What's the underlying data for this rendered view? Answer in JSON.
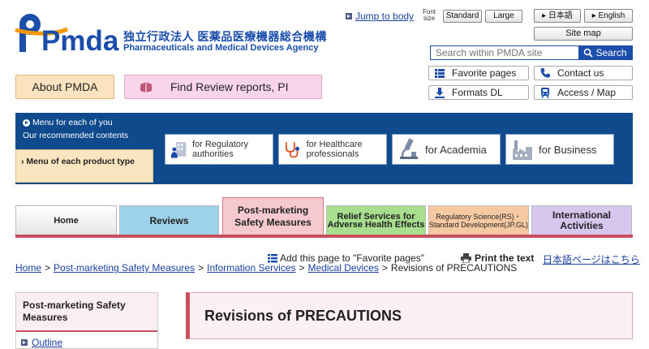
{
  "logo": {
    "text": "Pmda",
    "name_ja": "独立行政法人 医薬品医療機器総合機構",
    "name_en": "Pharmaceuticals and Medical Devices Agency"
  },
  "header": {
    "jump_to_body": "Jump to body",
    "font_size_label": "Font size",
    "font_standard": "Standard",
    "font_large": "Large",
    "lang_ja": "日本語",
    "lang_en": "English",
    "site_map": "Site map",
    "search_placeholder": "Search within PMDA site",
    "search_button": "Search",
    "favorite_pages": "Favorite pages",
    "contact_us": "Contact us",
    "formats_dl": "Formats DL",
    "access_map": "Access / Map"
  },
  "quick": {
    "about": "About PMDA",
    "review": "Find Review reports, PI"
  },
  "menu": {
    "for_you_line1": "Menu for each of you",
    "for_you_line2": "Our recommended contents",
    "product_type": "Menu of each product type",
    "cards": [
      {
        "label": "for Regulatory authorities"
      },
      {
        "label": "for Healthcare professionals"
      },
      {
        "label": "for Academia"
      },
      {
        "label": "for Business"
      }
    ]
  },
  "tabs": [
    {
      "label": "Home"
    },
    {
      "label": "Reviews"
    },
    {
      "label": "Post-marketing Safety Measures"
    },
    {
      "label": "Relief Services for Adverse Health Effects"
    },
    {
      "label": "Regulatory Science(RS)・Standard Development(JP,GL)"
    },
    {
      "label": "International Activities"
    }
  ],
  "tools": {
    "add_favorite": "Add this page to \"Favorite pages\"",
    "print": "Print the text",
    "japanese_page": "日本語ページはこちら"
  },
  "breadcrumb": {
    "home": "Home",
    "safety": "Post-marketing Safety Measures",
    "info": "Information Services",
    "devices": "Medical Devices",
    "current": "Revisions of PRECAUTIONS",
    "separator": ">"
  },
  "side": {
    "title": "Post-marketing Safety Measures",
    "outline": "Outline"
  },
  "main": {
    "title": "Revisions of PRECAUTIONS"
  },
  "colors": {
    "brand_blue": "#1b4dab",
    "band_blue": "#0e4a8c",
    "accent_red": "#c8505e"
  }
}
